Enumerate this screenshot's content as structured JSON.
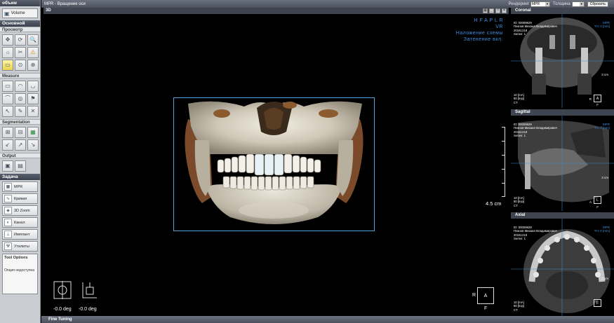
{
  "left_panel": {
    "header_volume": "объем",
    "volume_button": "Volume",
    "header_main": "Основной",
    "view_title": "Просмотр",
    "view_tools": [
      "✥",
      "⟳",
      "🔍",
      "☼",
      "✂",
      "⚠",
      "▭",
      "⊙",
      "⊕"
    ],
    "measure_title": "Measure",
    "measure_tools": [
      "▭",
      "◠",
      "◡",
      "⌒",
      "◎",
      "⚑",
      "↖",
      "✎",
      "✕"
    ],
    "segmentation_title": "Segmentation",
    "segmentation_tools": [
      "⊞",
      "⊟",
      "▦",
      "↙",
      "↗",
      "↘"
    ],
    "output_title": "Output",
    "output_tools": [
      "▣",
      "▤"
    ],
    "tasks_header": "Задача",
    "tasks": [
      {
        "label": "MPR",
        "icon": "▦"
      },
      {
        "label": "Кривая",
        "icon": "∿"
      },
      {
        "label": "3D Zoom",
        "icon": "◈"
      },
      {
        "label": "Канал",
        "icon": "◐"
      },
      {
        "label": "Имплант",
        "icon": "⊥"
      },
      {
        "label": "Утилиты",
        "icon": "⚒"
      }
    ],
    "tool_options_title": "Tool Options",
    "tool_options_text": "Опция недоступна"
  },
  "topbar": {
    "title": "MPR - Вращение оси",
    "render_label": "Рендеринг",
    "render_value": "MPR",
    "thickness_label": "Толщина",
    "thickness_value": "",
    "reset_button": "Сбросить"
  },
  "main_view": {
    "label": "3D",
    "orientation": "H F A P L R",
    "mode": "VR",
    "overlay_line1": "Наложение схемы",
    "overlay_line2": "Затенение вкл.",
    "scale_label": "4.5 cm",
    "rotation1": "-0.0 deg",
    "rotation2": "-0.0 deg",
    "cube_center": "A",
    "cube_left": "R",
    "cube_bottom": "F"
  },
  "panels": [
    {
      "title": "Coronal",
      "id_line": "ID: 00009629",
      "name": "Пекнов Михаил Владимирович",
      "date": "20161218",
      "series": "Series: 1",
      "tag": "MPR",
      "thickness": "TH: 0 [mm]",
      "ma": "10 [mA]",
      "kvp": "80 [kvp]",
      "modality": "CT",
      "cm": "3 cm",
      "box": "A",
      "box_left": "R",
      "box_bottom": "F"
    },
    {
      "title": "Sagittal",
      "id_line": "ID: 00009629",
      "name": "Пекнов Михаил Владимирович",
      "date": "20161218",
      "series": "Series: 1",
      "tag": "MPR",
      "thickness": "TH: 0 [mm]",
      "ma": "10 [mA]",
      "kvp": "80 [kvp]",
      "modality": "CT",
      "cm": "3 cm",
      "box": "L",
      "box_left": "A",
      "box_bottom": "F"
    },
    {
      "title": "Axial",
      "id_line": "ID: 00009629",
      "name": "Пекнов Михаил Владимирович",
      "date": "20161218",
      "series": "Series: 1",
      "tag": "MPR",
      "thickness": "TH: 0 [mm]",
      "ma": "10 [mA]",
      "kvp": "80 [kvp]",
      "modality": "CT",
      "cm": "3 cm",
      "box": "F",
      "box_left": "",
      "box_bottom": ""
    }
  ],
  "bottombar": {
    "title": "Fine Tuning"
  }
}
